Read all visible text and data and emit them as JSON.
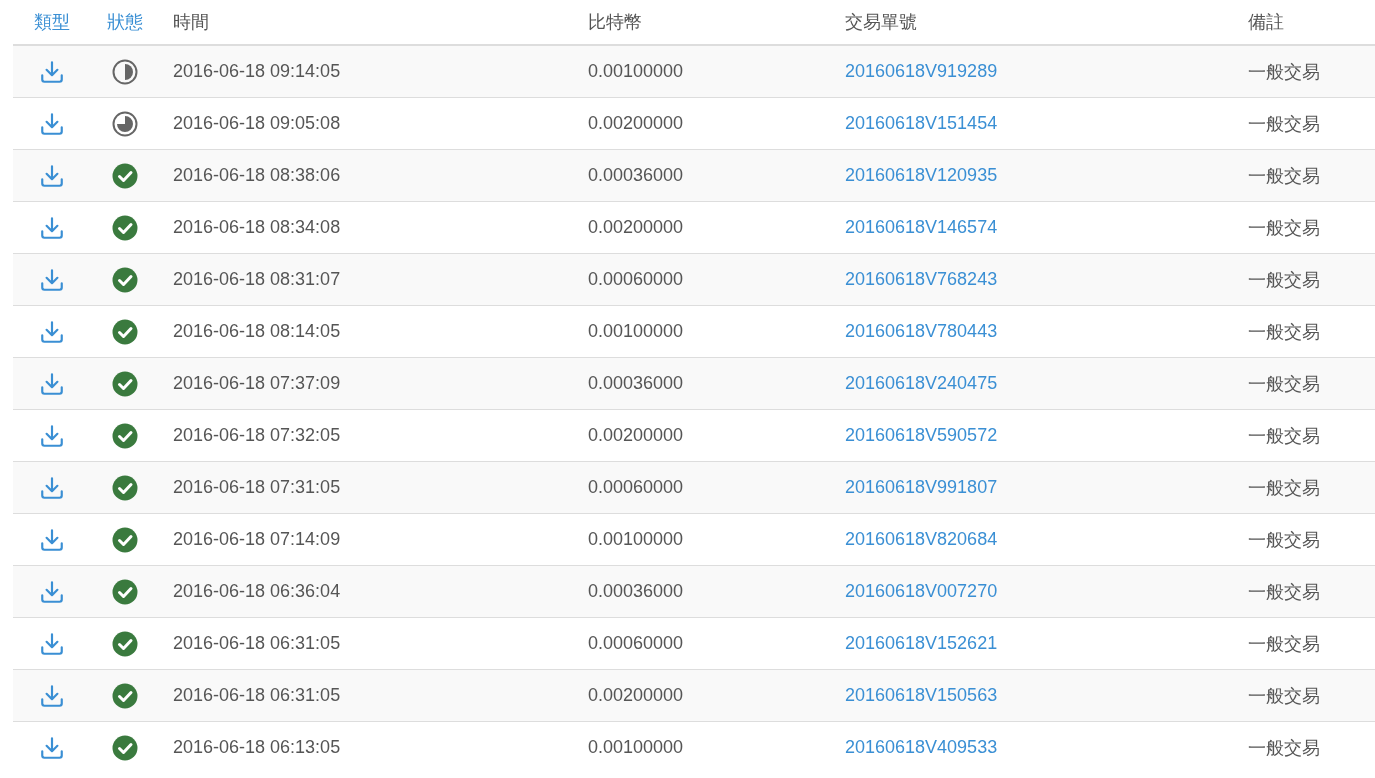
{
  "table": {
    "columns": [
      {
        "label": "類型",
        "sortable": true
      },
      {
        "label": "狀態",
        "sortable": true
      },
      {
        "label": "時間",
        "sortable": false
      },
      {
        "label": "比特幣",
        "sortable": false
      },
      {
        "label": "交易單號",
        "sortable": false
      },
      {
        "label": "備註",
        "sortable": false
      }
    ],
    "rows": [
      {
        "kind": "half",
        "time": "2016-06-18 09:14:05",
        "amount": "0.00100000",
        "tx": "20160618V919289",
        "note": "一般交易"
      },
      {
        "kind": "three-quarters",
        "time": "2016-06-18 09:05:08",
        "amount": "0.00200000",
        "tx": "20160618V151454",
        "note": "一般交易"
      },
      {
        "kind": "done",
        "time": "2016-06-18 08:38:06",
        "amount": "0.00036000",
        "tx": "20160618V120935",
        "note": "一般交易"
      },
      {
        "kind": "done",
        "time": "2016-06-18 08:34:08",
        "amount": "0.00200000",
        "tx": "20160618V146574",
        "note": "一般交易"
      },
      {
        "kind": "done",
        "time": "2016-06-18 08:31:07",
        "amount": "0.00060000",
        "tx": "20160618V768243",
        "note": "一般交易"
      },
      {
        "kind": "done",
        "time": "2016-06-18 08:14:05",
        "amount": "0.00100000",
        "tx": "20160618V780443",
        "note": "一般交易"
      },
      {
        "kind": "done",
        "time": "2016-06-18 07:37:09",
        "amount": "0.00036000",
        "tx": "20160618V240475",
        "note": "一般交易"
      },
      {
        "kind": "done",
        "time": "2016-06-18 07:32:05",
        "amount": "0.00200000",
        "tx": "20160618V590572",
        "note": "一般交易"
      },
      {
        "kind": "done",
        "time": "2016-06-18 07:31:05",
        "amount": "0.00060000",
        "tx": "20160618V991807",
        "note": "一般交易"
      },
      {
        "kind": "done",
        "time": "2016-06-18 07:14:09",
        "amount": "0.00100000",
        "tx": "20160618V820684",
        "note": "一般交易"
      },
      {
        "kind": "done",
        "time": "2016-06-18 06:36:04",
        "amount": "0.00036000",
        "tx": "20160618V007270",
        "note": "一般交易"
      },
      {
        "kind": "done",
        "time": "2016-06-18 06:31:05",
        "amount": "0.00060000",
        "tx": "20160618V152621",
        "note": "一般交易"
      },
      {
        "kind": "done",
        "time": "2016-06-18 06:31:05",
        "amount": "0.00200000",
        "tx": "20160618V150563",
        "note": "一般交易"
      },
      {
        "kind": "done",
        "time": "2016-06-18 06:13:05",
        "amount": "0.00100000",
        "tx": "20160618V409533",
        "note": "一般交易"
      }
    ]
  }
}
